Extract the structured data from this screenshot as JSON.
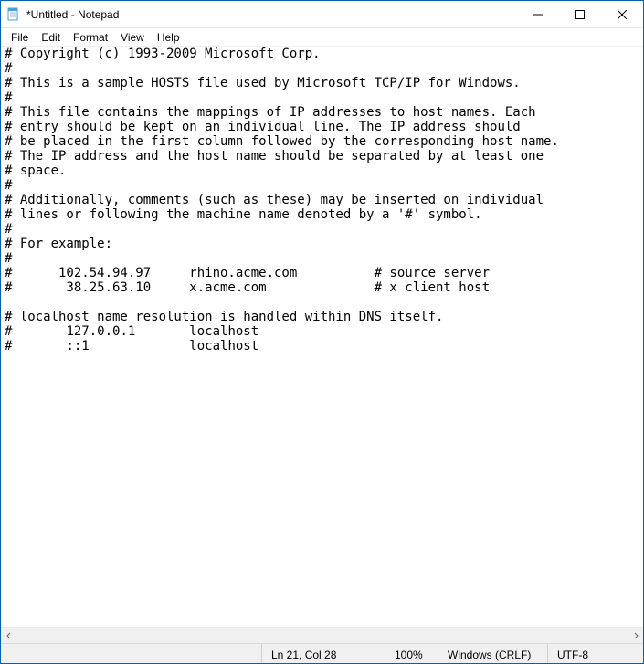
{
  "window": {
    "title": "*Untitled - Notepad"
  },
  "menu": {
    "file": "File",
    "edit": "Edit",
    "format": "Format",
    "view": "View",
    "help": "Help"
  },
  "editor": {
    "content": "# Copyright (c) 1993-2009 Microsoft Corp.\n#\n# This is a sample HOSTS file used by Microsoft TCP/IP for Windows.\n#\n# This file contains the mappings of IP addresses to host names. Each\n# entry should be kept on an individual line. The IP address should\n# be placed in the first column followed by the corresponding host name.\n# The IP address and the host name should be separated by at least one\n# space.\n#\n# Additionally, comments (such as these) may be inserted on individual\n# lines or following the machine name denoted by a '#' symbol.\n#\n# For example:\n#\n#      102.54.94.97     rhino.acme.com          # source server\n#       38.25.63.10     x.acme.com              # x client host\n\n# localhost name resolution is handled within DNS itself.\n#\t127.0.0.1       localhost\n#\t::1             localhost"
  },
  "status": {
    "position": "Ln 21, Col 28",
    "zoom": "100%",
    "line_ending": "Windows (CRLF)",
    "encoding": "UTF-8"
  }
}
